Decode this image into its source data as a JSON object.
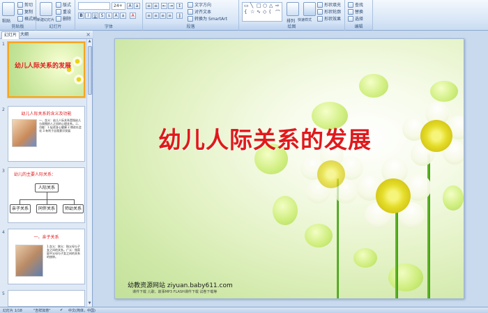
{
  "ribbon": {
    "clipboard": {
      "label": "剪贴板",
      "paste": "粘贴",
      "cut": "剪切",
      "copy": "复制",
      "format_painter": "格式刷"
    },
    "slides": {
      "label": "幻灯片",
      "new_slide": "新建幻灯片",
      "layout": "版式",
      "reset": "重设",
      "delete": "删除"
    },
    "font": {
      "label": "字体",
      "font_size": "24+"
    },
    "paragraph": {
      "label": "段落",
      "text_direction": "文字方向",
      "align_text": "对齐文本",
      "smartart": "转换为 SmartArt"
    },
    "drawing": {
      "label": "绘图",
      "arrange": "排列",
      "quick_styles": "快速样式",
      "shape_fill": "形状填充",
      "shape_outline": "形状轮廓",
      "shape_effects": "形状效果"
    },
    "editing": {
      "label": "编辑",
      "find": "查找",
      "replace": "替换",
      "select": "选择"
    }
  },
  "left_pane": {
    "tabs": [
      "幻灯片",
      "大纲"
    ],
    "thumbs": [
      {
        "num": "1",
        "title": "幼儿人际关系的发展"
      },
      {
        "num": "2",
        "title": "幼儿人际关系的含义及功能",
        "text": "一、含义：幼儿人际关系是指幼儿与周围的人之间的心理关系。二、功能：1.促进身心健康 2.增进社会化 3.有利于自我意识发展"
      },
      {
        "num": "3",
        "title": "幼儿的主要人际关系：",
        "root": "人际关系",
        "children": [
          "亲子关系",
          "同伴关系",
          "师幼关系"
        ]
      },
      {
        "num": "4",
        "title": "一、亲子关系",
        "text": "1.含义：狭义：指父母与子女之间的关系。广义：指家庭中父母与子女之间的关系的统称。"
      },
      {
        "num": "5"
      }
    ]
  },
  "slide": {
    "title": "幼儿人际关系的发展",
    "footer": "幼教资源网站  ziyuan.baby611.com",
    "sub": "课件下载   儿歌、故事MP3   FLASH课件下载   试卷下载等"
  },
  "status": {
    "slide_info": "幻灯片 1/18",
    "theme": "\"吉祥如意\"",
    "language": "中文(简体，中国)"
  }
}
